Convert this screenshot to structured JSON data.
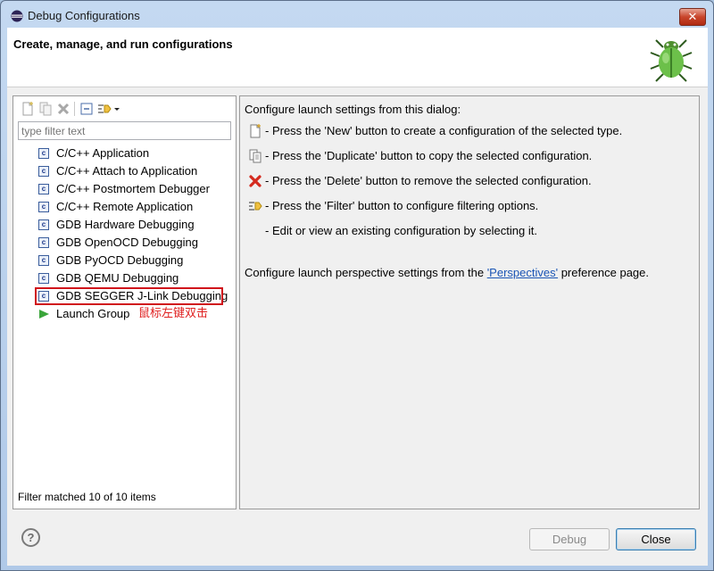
{
  "window": {
    "title": "Debug Configurations",
    "close_glyph": "✕"
  },
  "banner": {
    "title": "Create, manage, and run configurations",
    "icon": "bug-icon"
  },
  "left": {
    "toolbar": [
      "new-config-icon",
      "duplicate-icon",
      "delete-icon",
      "collapse-all-icon",
      "filter-icon",
      "dropdown-arrow-icon"
    ],
    "filter_placeholder": "type filter text",
    "items": [
      {
        "label": "C/C++ Application",
        "icon": "c-icon"
      },
      {
        "label": "C/C++ Attach to Application",
        "icon": "c-icon"
      },
      {
        "label": "C/C++ Postmortem Debugger",
        "icon": "c-icon"
      },
      {
        "label": "C/C++ Remote Application",
        "icon": "c-icon"
      },
      {
        "label": "GDB Hardware Debugging",
        "icon": "c-icon"
      },
      {
        "label": "GDB OpenOCD Debugging",
        "icon": "c-icon"
      },
      {
        "label": "GDB PyOCD Debugging",
        "icon": "c-icon"
      },
      {
        "label": "GDB QEMU Debugging",
        "icon": "c-icon"
      },
      {
        "label": "GDB SEGGER J-Link Debugging",
        "icon": "c-icon",
        "highlighted": true
      },
      {
        "label": "Launch Group",
        "icon": "play-icon"
      }
    ],
    "annotation": "鼠标左键双击",
    "status": "Filter matched 10 of 10 items"
  },
  "right": {
    "intro": "Configure launch settings from this dialog:",
    "hints": [
      {
        "icon": "new-icon",
        "text": "- Press the 'New' button to create a configuration of the selected type."
      },
      {
        "icon": "duplicate-icon",
        "text": "- Press the 'Duplicate' button to copy the selected configuration."
      },
      {
        "icon": "delete-icon",
        "text": "- Press the 'Delete' button to remove the selected configuration."
      },
      {
        "icon": "filter-icon",
        "text": "- Press the 'Filter' button to configure filtering options."
      },
      {
        "icon": "",
        "text": "- Edit or view an existing configuration by selecting it."
      }
    ],
    "perspective_prefix": "Configure launch perspective settings from the ",
    "perspective_link": "'Perspectives'",
    "perspective_suffix": " preference page."
  },
  "footer": {
    "help_glyph": "?",
    "debug_label": "Debug",
    "close_label": "Close"
  },
  "colors": {
    "highlight_border": "#d0121b",
    "annotation": "#e02020",
    "link": "#1a55b5"
  }
}
